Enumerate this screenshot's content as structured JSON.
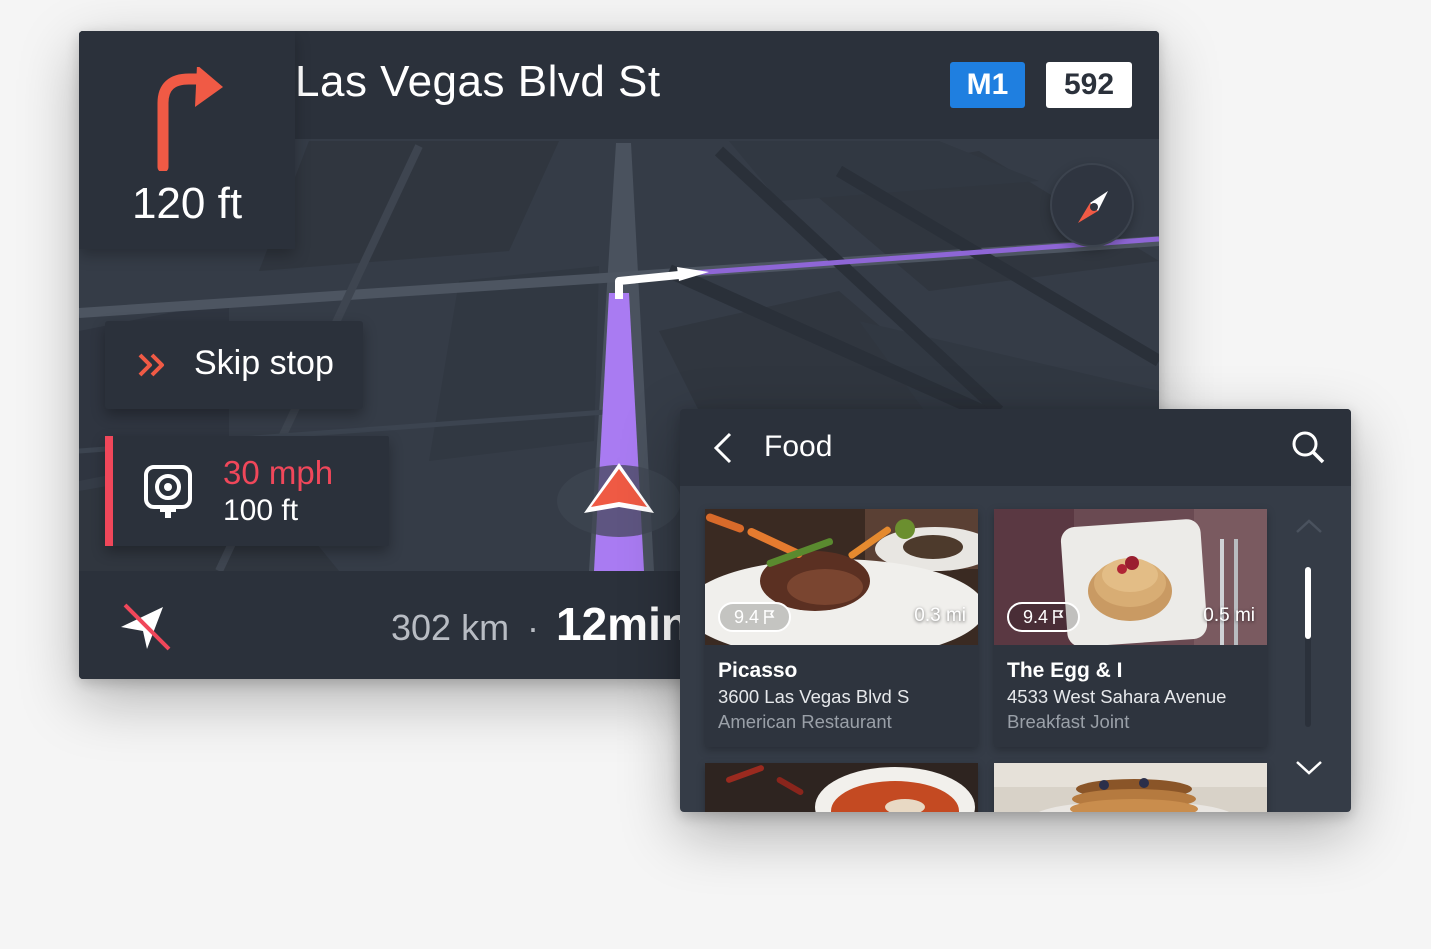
{
  "nav": {
    "street": "Las Vegas Blvd St",
    "badges": {
      "primary": "M1",
      "secondary": "592"
    },
    "turn": {
      "distance": "120 ft",
      "direction_icon": "turn-right-icon"
    },
    "skip_stop": {
      "label": "Skip stop"
    },
    "speed_camera": {
      "limit": "30 mph",
      "distance": "100 ft"
    },
    "footer": {
      "distance": "302 km",
      "separator": "·",
      "time": "12min"
    }
  },
  "food": {
    "title": "Food",
    "cards": [
      {
        "rating": "9.4",
        "distance": "0.3 mi",
        "name": "Picasso",
        "address": "3600 Las Vegas Blvd S",
        "category": "American Restaurant"
      },
      {
        "rating": "9.4",
        "distance": "0.5 mi",
        "name": "The Egg & I",
        "address": "4533 West Sahara Avenue",
        "category": "Breakfast Joint"
      }
    ]
  },
  "colors": {
    "accent": "#f05a45",
    "speed_warning": "#f0475a",
    "route": "#a97bf2",
    "badge_blue": "#1f7fe0",
    "panel_dark": "#2b313b",
    "map_bg": "#353c47"
  }
}
